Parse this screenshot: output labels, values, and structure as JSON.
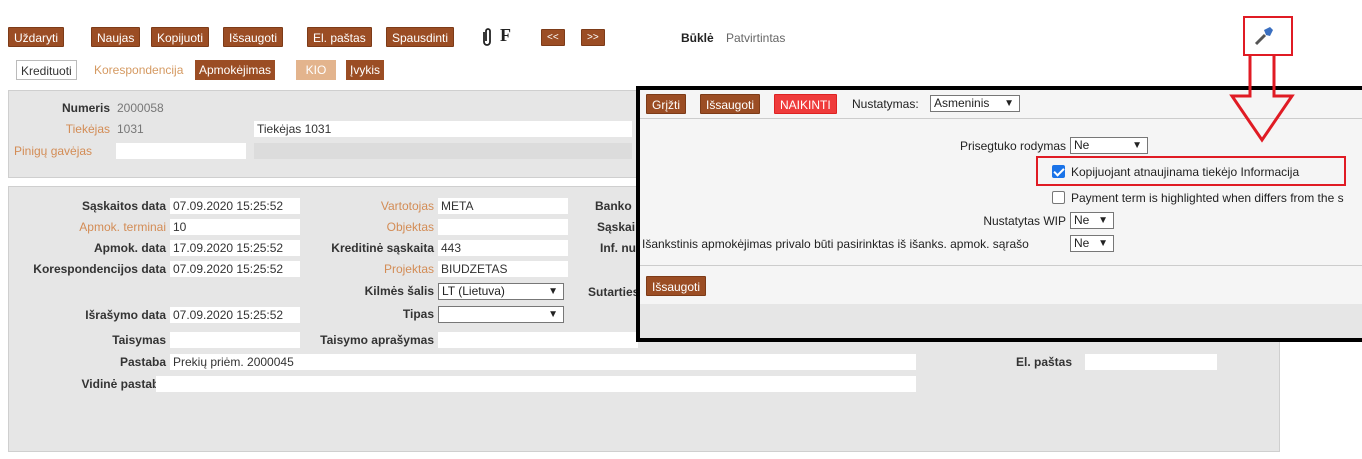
{
  "toolbar": {
    "close": "Uždaryti",
    "new": "Naujas",
    "copy": "Kopijuoti",
    "save": "Išsaugoti",
    "email": "El. paštas",
    "print": "Spausdinti",
    "attach_icon": "paperclip-icon",
    "f_label": "F",
    "prev": "<<",
    "next": ">>",
    "status_label": "Būklė",
    "status_value": "Patvirtintas",
    "wrench_icon": "wrench-icon"
  },
  "tabs": {
    "credit": "Kredituoti",
    "correspondence": "Korespondencija",
    "payment": "Apmokėjimas",
    "kio": "KIO",
    "event": "Įvykis"
  },
  "header_form": {
    "number_label": "Numeris",
    "number_value": "2000058",
    "supplier_label": "Tiekėjas",
    "supplier_code": "1031",
    "supplier_name": "Tiekėjas 1031",
    "payee_label": "Pinigų gavėjas"
  },
  "details": {
    "invoice_date_label": "Sąskaitos data",
    "invoice_date": "07.09.2020 15:25:52",
    "pay_terms_label": "Apmok. terminai",
    "pay_terms": "10",
    "pay_date_label": "Apmok. data",
    "pay_date": "17.09.2020 15:25:52",
    "corr_date_label": "Korespondencijos data",
    "corr_date": "07.09.2020 15:25:52",
    "issue_date_label": "Išrašymo data",
    "issue_date": "07.09.2020 15:25:52",
    "fix_label": "Taisymas",
    "user_label": "Vartotojas",
    "user": "META",
    "object_label": "Objektas",
    "credit_acc_label": "Kreditinė sąskaita",
    "credit_acc": "443",
    "project_label": "Projektas",
    "project": "BIUDZETAS",
    "origin_label": "Kilmės šalis",
    "origin": "LT (Lietuva)",
    "type_label": "Tipas",
    "type": "",
    "fix_desc_label": "Taisymo aprašymas",
    "bank_label": "Banko",
    "acc_label": "Sąskai",
    "infnum_label": "Inf. nu",
    "contract_label": "Sutarties",
    "note_label": "Pastaba",
    "note": "Prekių priėm. 2000045",
    "internal_note_label": "Vidinė pastaba",
    "email_label": "El. paštas"
  },
  "popup": {
    "back": "Grįžti",
    "save": "Išsaugoti",
    "delete": "NAIKINTI",
    "settings_label": "Nustatymas:",
    "settings_value": "Asmeninis",
    "attach_display_label": "Prisegtuko rodymas",
    "attach_display_value": "Ne",
    "copy_update_label": "Kopijuojant atnaujinama tiekėjo Informacija",
    "copy_update_checked": true,
    "payment_term_label": "Payment term is highlighted when differs from the s",
    "payment_term_checked": false,
    "wip_label": "Nustatytas WIP",
    "wip_value": "Ne",
    "prepay_label": "Išankstinis apmokėjimas privalo būti pasirinktas iš išanks. apmok. sąrašo",
    "prepay_value": "Ne",
    "save_bottom": "Išsaugoti"
  },
  "colors": {
    "accent": "#9b4d24",
    "highlight": "#e01b24",
    "checkbox": "#1a73e8"
  }
}
